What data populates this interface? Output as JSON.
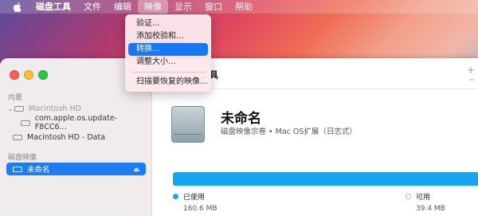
{
  "menubar": {
    "app_name": "磁盘工具",
    "items": [
      "文件",
      "编辑",
      "映像",
      "显示",
      "窗口",
      "帮助"
    ],
    "active_menu": "映像"
  },
  "dropdown": {
    "items": [
      "验证...",
      "添加校验和...",
      "转换...",
      "调整大小...",
      "扫描要恢复的映像..."
    ],
    "highlighted": "转换..."
  },
  "sidebar": {
    "section_internal": "内置",
    "internal_items": [
      "Macintosh HD",
      "com.apple.os.update-F8CC6...",
      "Macintosh HD - Data"
    ],
    "section_images": "磁盘映像",
    "image_items": [
      "未命名"
    ]
  },
  "toolbar": {
    "title": "工具",
    "plus": "+",
    "minus": "−"
  },
  "volume": {
    "name": "未命名",
    "subtitle": "磁盘映像宗卷 • Mac OS扩展（日志式）",
    "used_label": "已使用",
    "used_value": "160.6 MB",
    "free_label": "可用",
    "free_value": "39.4 MB",
    "used_fraction": 0.803
  },
  "colors": {
    "accent": "#1e7cf0",
    "usage_bar": "#1aa3ef"
  },
  "icons": {
    "apple": "apple-logo-icon",
    "disk": "hard-disk-icon",
    "eject": "eject-icon",
    "chevron": "chevron-down-icon"
  }
}
